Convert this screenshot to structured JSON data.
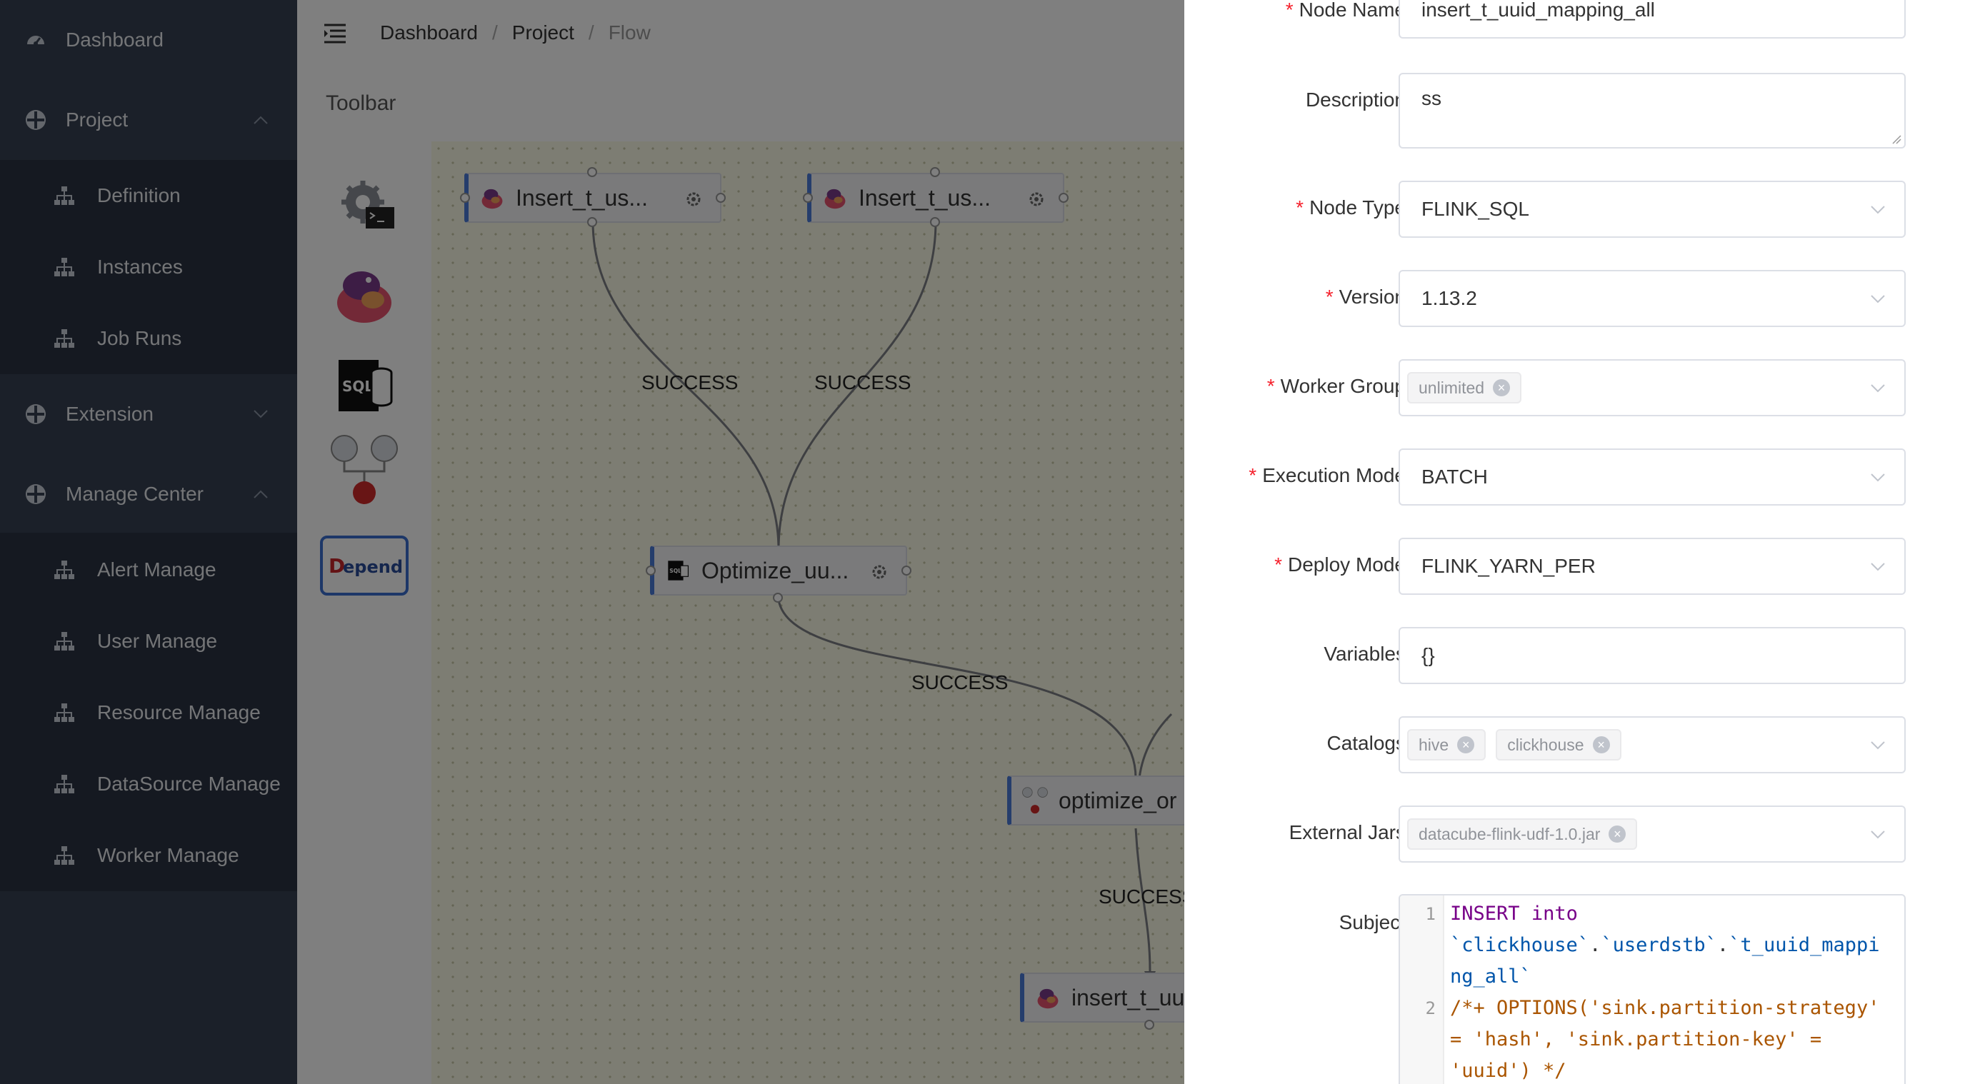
{
  "sidebar": {
    "items": [
      {
        "label": "Dashboard",
        "icon": "dashboard-icon"
      },
      {
        "label": "Project",
        "icon": "project-icon",
        "expanded": true
      },
      {
        "label": "Definition",
        "icon": "sitemap-icon"
      },
      {
        "label": "Instances",
        "icon": "sitemap-icon"
      },
      {
        "label": "Job Runs",
        "icon": "sitemap-icon"
      },
      {
        "label": "Extension",
        "icon": "extension-icon",
        "expanded": false
      },
      {
        "label": "Manage Center",
        "icon": "manage-center-icon",
        "expanded": true
      },
      {
        "label": "Alert Manage",
        "icon": "sitemap-icon"
      },
      {
        "label": "User Manage",
        "icon": "sitemap-icon"
      },
      {
        "label": "Resource Manage",
        "icon": "sitemap-icon"
      },
      {
        "label": "DataSource Manage",
        "icon": "sitemap-icon"
      },
      {
        "label": "Worker Manage",
        "icon": "sitemap-icon"
      }
    ]
  },
  "breadcrumb": {
    "items": [
      "Dashboard",
      "Project",
      "Flow"
    ],
    "separator": "/"
  },
  "toolbar": {
    "title": "Toolbar",
    "tools": [
      "shell-task-icon",
      "flink-task-icon",
      "flink-sql-task-icon",
      "condition-task-icon",
      "depend-task-icon"
    ]
  },
  "canvas": {
    "nodes": [
      {
        "label": "Insert_t_us...",
        "type": "flink"
      },
      {
        "label": "Insert_t_us...",
        "type": "flink"
      },
      {
        "label": "Optimize_uu...",
        "type": "sql"
      },
      {
        "label": "optimize_or",
        "type": "condition"
      },
      {
        "label": "insert_t_uu",
        "type": "flink"
      }
    ],
    "edge_labels": [
      "SUCCESS",
      "SUCCESS",
      "SUCCESS",
      "SUCCESS"
    ]
  },
  "form": {
    "node_name": {
      "label": "Node Name",
      "value": "insert_t_uuid_mapping_all",
      "required": true
    },
    "description": {
      "label": "Description",
      "value": "ss",
      "required": false
    },
    "node_type": {
      "label": "Node Type",
      "value": "FLINK_SQL",
      "required": true
    },
    "version": {
      "label": "Version",
      "value": "1.13.2",
      "required": true
    },
    "worker_group": {
      "label": "Worker Group",
      "tags": [
        "unlimited"
      ],
      "required": true
    },
    "execution_mode": {
      "label": "Execution Mode",
      "value": "BATCH",
      "required": true
    },
    "deploy_mode": {
      "label": "Deploy Mode",
      "value": "FLINK_YARN_PER",
      "required": true
    },
    "variables": {
      "label": "Variables",
      "value": "{}",
      "required": false
    },
    "catalogs": {
      "label": "Catalogs",
      "tags": [
        "hive",
        "clickhouse"
      ],
      "required": false
    },
    "external_jars": {
      "label": "External Jars",
      "tags": [
        "datacube-flink-udf-1.0.jar"
      ],
      "required": false
    },
    "subject": {
      "label": "Subject",
      "line_numbers": [
        "1",
        "2"
      ],
      "lines": [
        {
          "kw1": "INSERT",
          "kw2": "into"
        },
        {
          "id1": "`clickhouse`",
          "dot1": ".",
          "id2": "`userdstb`",
          "dot2": ".",
          "id3": "`t_uuid_mappi"
        },
        {
          "id1": "ng_all`"
        },
        {
          "cm": "/*+ OPTIONS('sink.partition-strategy'"
        },
        {
          "cm": "= 'hash', 'sink.partition-key' ="
        },
        {
          "cm": "'uuid') */"
        }
      ]
    }
  },
  "colors": {
    "sidebar_bg": "#364152",
    "sidebar_sub_bg": "#2a3342",
    "required": "#f5222d",
    "node_accent": "#4a7bd9",
    "keyword": "#770088",
    "identifier": "#0055aa",
    "comment": "#aa5500"
  }
}
